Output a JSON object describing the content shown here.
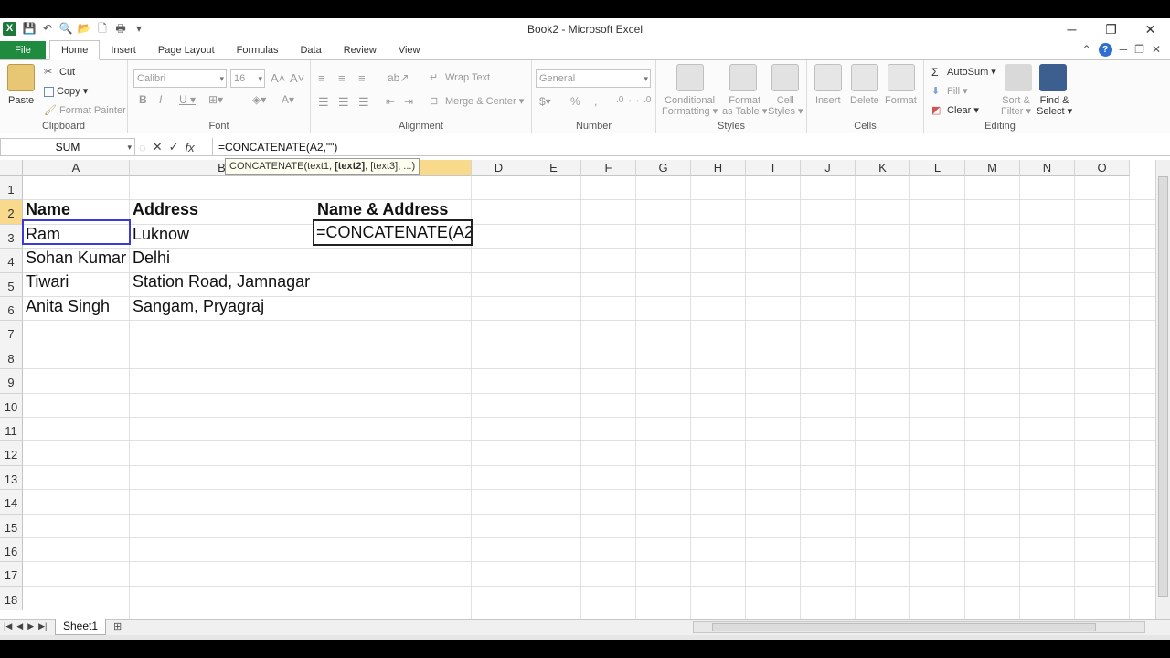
{
  "window": {
    "app_icon_letter": "X",
    "title": "Book2 - Microsoft Excel",
    "controls": [
      "─",
      "❐",
      "✕"
    ]
  },
  "ribbon_tabs": [
    "File",
    "Home",
    "Insert",
    "Page Layout",
    "Formulas",
    "Data",
    "Review",
    "View"
  ],
  "active_tab": "Home",
  "clipboard": {
    "paste": "Paste",
    "cut": "Cut",
    "copy": "Copy ▾",
    "format_painter": "Format Painter",
    "label": "Clipboard"
  },
  "font": {
    "name": "Calibri",
    "size": "16",
    "bold": "B",
    "italic": "I",
    "underline": "U ▾",
    "label": "Font"
  },
  "alignment": {
    "wrap_text": "Wrap Text",
    "merge_center": "Merge & Center ▾",
    "label": "Alignment"
  },
  "number": {
    "format": "General",
    "percent": "%",
    "comma": ",",
    "label": "Number"
  },
  "styles": {
    "conditional": [
      "Conditional",
      "Formatting ▾"
    ],
    "format_table": [
      "Format",
      "as Table ▾"
    ],
    "cell_styles": [
      "Cell",
      "Styles ▾"
    ],
    "label": "Styles"
  },
  "cells": {
    "insert": "Insert",
    "delete": "Delete",
    "format": "Format",
    "label": "Cells"
  },
  "editing": {
    "autosum": "AutoSum ▾",
    "fill": "Fill ▾",
    "clear": "Clear ▾",
    "sort_filter": [
      "Sort &",
      "Filter ▾"
    ],
    "find_select": [
      "Find &",
      "Select ▾"
    ],
    "label": "Editing"
  },
  "formula_bar": {
    "name_box": "SUM",
    "formula": "=CONCATENATE(A2,\"\")",
    "fx": "fx"
  },
  "tooltip": {
    "prefix": "CONCATENATE(text1, ",
    "bold": "[text2]",
    "suffix": ", [text3], ...)"
  },
  "columns": [
    "A",
    "B",
    "C",
    "D",
    "E",
    "F",
    "G",
    "H",
    "I",
    "J",
    "K",
    "L",
    "M",
    "N",
    "O"
  ],
  "rows": [
    "1",
    "2",
    "3",
    "4",
    "5",
    "6",
    "7",
    "8",
    "9",
    "10",
    "11",
    "12",
    "13",
    "14",
    "15",
    "16",
    "17",
    "18"
  ],
  "sheet": {
    "A1": "Name",
    "B1": "Address",
    "C1": "Name & Address",
    "A2": "Ram",
    "B2": "Luknow",
    "A3": "Sohan Kumar",
    "B3": "Delhi",
    "A4": "Tiwari",
    "B4": "Station Road, Jamnagar",
    "A5": "Anita Singh",
    "B5": "Sangam, Pryagraj",
    "C2_editing": "=CONCATENATE(A2,\""
  },
  "sheet_tabs": [
    "Sheet1"
  ],
  "colors": {
    "file_tab": "#1e8b3e",
    "selected_header": "#f9d98b",
    "ref_border": "#3a3ad6"
  }
}
